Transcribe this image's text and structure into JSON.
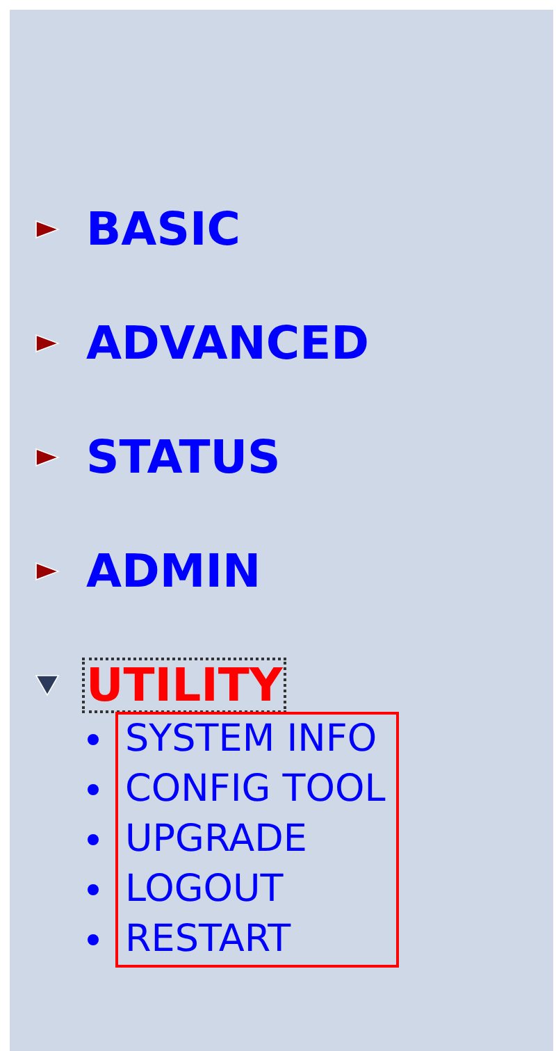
{
  "menu": [
    {
      "label": "BASIC",
      "expanded": false,
      "selected": false,
      "focused": false
    },
    {
      "label": "ADVANCED",
      "expanded": false,
      "selected": false,
      "focused": false
    },
    {
      "label": "STATUS",
      "expanded": false,
      "selected": false,
      "focused": false
    },
    {
      "label": "ADMIN",
      "expanded": false,
      "selected": false,
      "focused": false
    },
    {
      "label": "UTILITY",
      "expanded": true,
      "selected": true,
      "focused": true,
      "children": [
        {
          "label": "SYSTEM INFO"
        },
        {
          "label": "CONFIG TOOL"
        },
        {
          "label": "UPGRADE"
        },
        {
          "label": "LOGOUT"
        },
        {
          "label": "RESTART"
        }
      ]
    }
  ]
}
